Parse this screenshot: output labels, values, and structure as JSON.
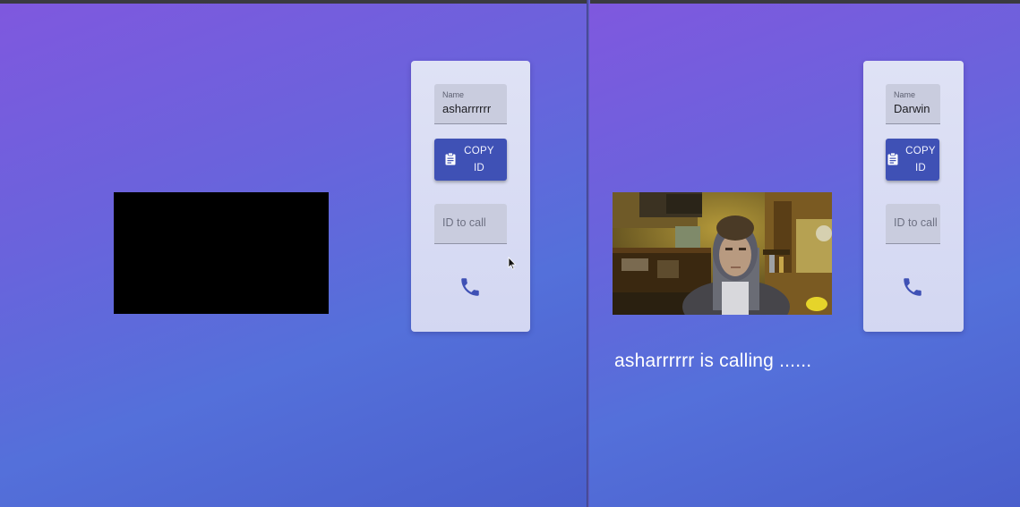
{
  "left_client": {
    "name_label": "Name",
    "name_value": "asharrrrrr",
    "copy_button_line1": "COPY",
    "copy_button_line2": "ID",
    "call_placeholder": "ID to call",
    "icons": {
      "copy": "clipboard-icon",
      "call": "phone-icon"
    }
  },
  "right_client": {
    "name_label": "Name",
    "name_value": "Darwin",
    "copy_button_line1": "COPY",
    "copy_button_line2": "ID",
    "call_placeholder": "ID to call",
    "calling_message": "asharrrrrr is calling ......",
    "icons": {
      "copy": "clipboard-icon",
      "call": "phone-icon"
    }
  },
  "colors": {
    "gradient_start": "#7f58de",
    "gradient_end": "#4a5fcc",
    "button": "#3f51b5",
    "card": "#d8dcf4"
  }
}
